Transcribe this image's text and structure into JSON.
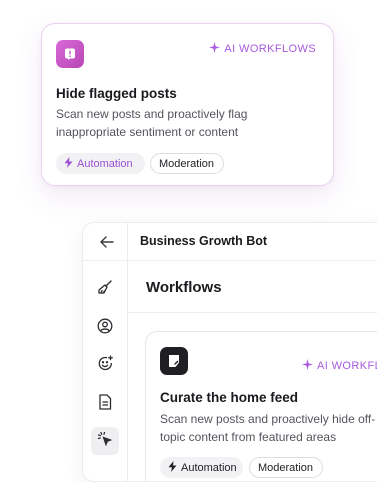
{
  "top_card": {
    "ai_tag": "AI WORKFLOWS",
    "title": "Hide flagged posts",
    "description": "Scan new posts and proactively flag inappropriate sentiment or content",
    "chips": {
      "automation": "Automation",
      "moderation": "Moderation"
    },
    "icon": "flag-alert-icon"
  },
  "window": {
    "title": "Business Growth Bot",
    "page_title": "Workflows",
    "sidebar": [
      {
        "icon": "broom-icon",
        "active": false
      },
      {
        "icon": "user-circle-icon",
        "active": false
      },
      {
        "icon": "smiley-sparkle-icon",
        "active": false
      },
      {
        "icon": "document-icon",
        "active": false
      },
      {
        "icon": "cursor-click-icon",
        "active": true
      }
    ],
    "card": {
      "ai_tag": "AI WORKFLOWS",
      "title": "Curate the home feed",
      "description": "Scan new posts and proactively hide off-topic content from featured areas",
      "chips": {
        "automation": "Automation",
        "moderation": "Moderation"
      },
      "icon": "edit-doc-icon"
    }
  },
  "colors": {
    "accent": "#a85ae0",
    "pink_icon": "#c955c9",
    "dark_icon": "#1f1f24"
  }
}
